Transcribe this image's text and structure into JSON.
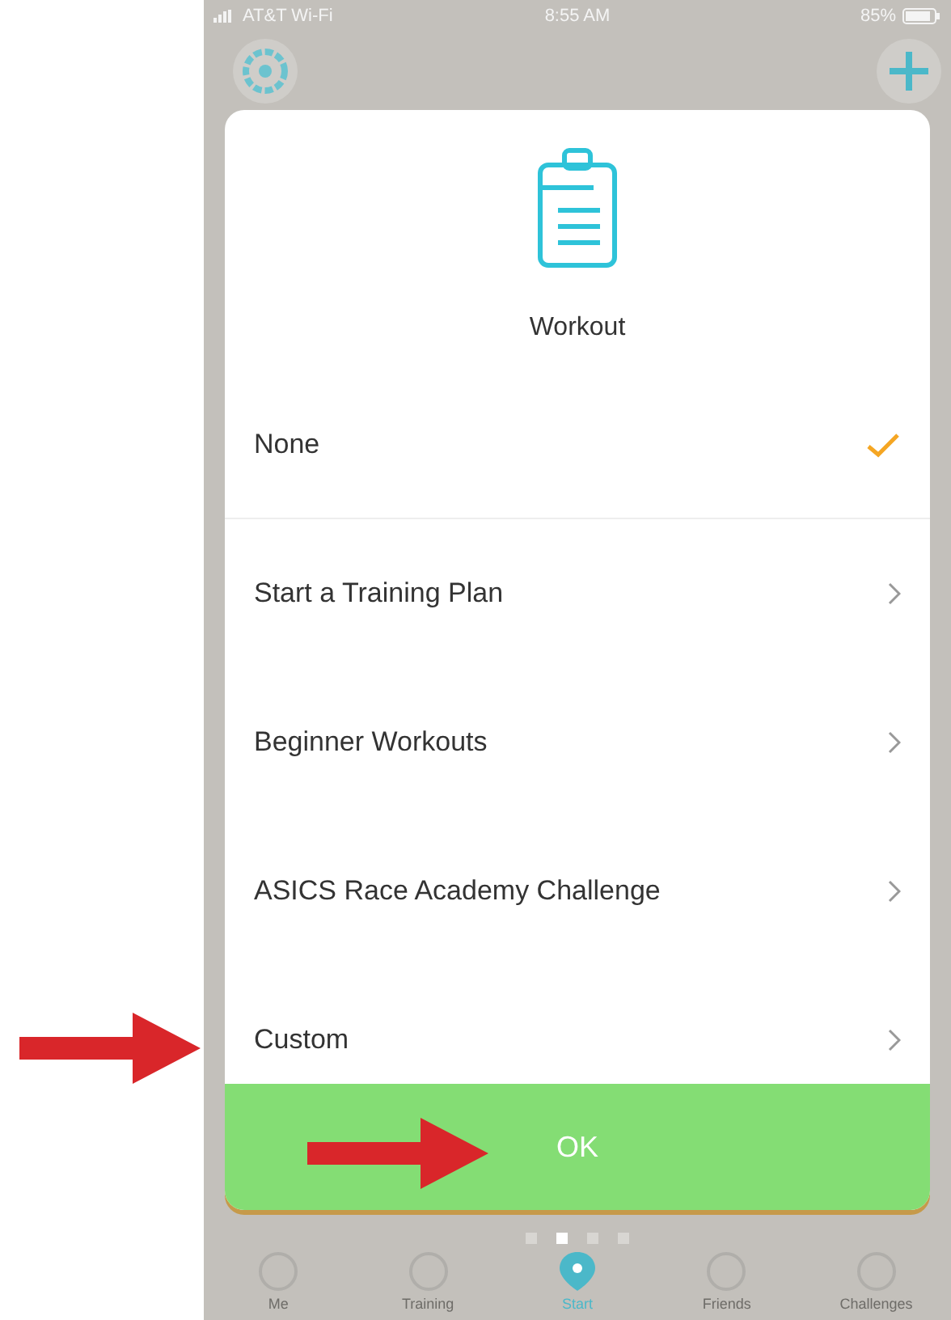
{
  "status_bar": {
    "carrier": "AT&T Wi-Fi",
    "time": "8:55 AM",
    "battery": "85%"
  },
  "modal": {
    "title": "Workout",
    "options": [
      {
        "label": "None",
        "selected": true
      },
      {
        "label": "Start a Training Plan",
        "selected": false
      },
      {
        "label": "Beginner Workouts",
        "selected": false
      },
      {
        "label": "ASICS Race Academy Challenge",
        "selected": false
      },
      {
        "label": "Custom",
        "selected": false
      }
    ],
    "ok_button": "OK"
  },
  "page_dots": [
    {
      "selected": false
    },
    {
      "selected": true
    },
    {
      "selected": false
    },
    {
      "selected": false
    }
  ],
  "tab_bar": [
    {
      "label": "Me",
      "selected": false
    },
    {
      "label": "Training",
      "selected": false
    },
    {
      "label": "Start",
      "selected": true
    },
    {
      "label": "Friends",
      "selected": false
    },
    {
      "label": "Challenges",
      "selected": false
    }
  ]
}
